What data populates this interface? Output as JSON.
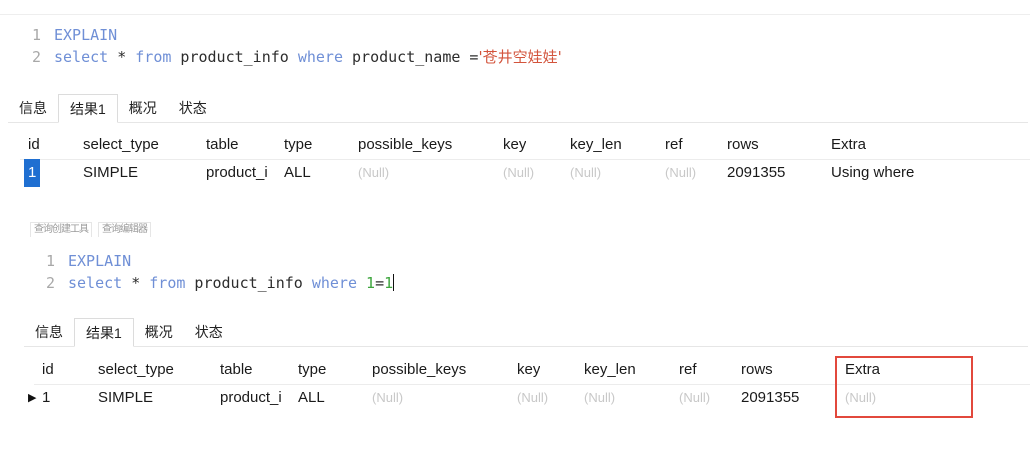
{
  "panel1": {
    "code": {
      "line1": {
        "num": "1",
        "keyword": "EXPLAIN"
      },
      "line2": {
        "num": "2",
        "kw_select": "select",
        "star": " * ",
        "kw_from": "from",
        "table": " product_info ",
        "kw_where": "where",
        "cond": " product_name =",
        "value": "'苍井空娃娃'"
      }
    },
    "tabs": [
      "信息",
      "结果1",
      "概况",
      "状态"
    ],
    "grid": {
      "headers": [
        "id",
        "select_type",
        "table",
        "type",
        "possible_keys",
        "key",
        "key_len",
        "ref",
        "rows",
        "Extra"
      ],
      "row": {
        "id": "1",
        "select_type": "SIMPLE",
        "table": "product_i",
        "type": "ALL",
        "possible_keys": "(Null)",
        "key": "(Null)",
        "key_len": "(Null)",
        "ref": "(Null)",
        "rows": "2091355",
        "extra": "Using where"
      }
    }
  },
  "panel2": {
    "editor_tabs": [
      "查询创建工具",
      "查询编辑器"
    ],
    "code": {
      "line1": {
        "num": "1",
        "keyword": "EXPLAIN"
      },
      "line2": {
        "num": "2",
        "kw_select": "select",
        "star": " * ",
        "kw_from": "from",
        "table": " product_info ",
        "kw_where": "where",
        "cond_left": " 1",
        "cond_op": "=",
        "cond_right": "1"
      }
    },
    "tabs": [
      "信息",
      "结果1",
      "概况",
      "状态"
    ],
    "grid": {
      "headers": [
        "id",
        "select_type",
        "table",
        "type",
        "possible_keys",
        "key",
        "key_len",
        "ref",
        "rows",
        "Extra"
      ],
      "row": {
        "marker": "▶",
        "id": "1",
        "select_type": "SIMPLE",
        "table": "product_i",
        "type": "ALL",
        "possible_keys": "(Null)",
        "key": "(Null)",
        "key_len": "(Null)",
        "ref": "(Null)",
        "rows": "2091355",
        "extra": "(Null)"
      }
    }
  },
  "colors": {
    "accent": "#1f6fd1",
    "highlight": "#e2483c",
    "keyword": "#6f8fd6",
    "string": "#d3543c",
    "number": "#3da53d"
  }
}
